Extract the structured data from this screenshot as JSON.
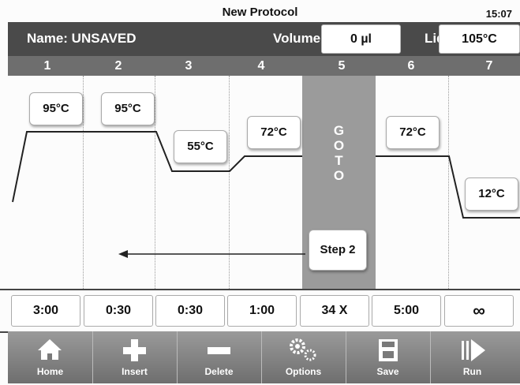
{
  "header": {
    "title": "New Protocol",
    "time": "15:07"
  },
  "protocol": {
    "name_label": "Name: UNSAVED",
    "volume_label": "Volume",
    "volume_value": "0 µl",
    "lid_label": "Lid",
    "lid_value": "105°C"
  },
  "steps": [
    {
      "number": "1",
      "temp": "95°C",
      "duration": "3:00"
    },
    {
      "number": "2",
      "temp": "95°C",
      "duration": "0:30"
    },
    {
      "number": "3",
      "temp": "55°C",
      "duration": "0:30"
    },
    {
      "number": "4",
      "temp": "72°C",
      "duration": "1:00"
    },
    {
      "number": "5",
      "goto_text": "G\nO\nT\nO",
      "goto_target": "Step 2",
      "duration": "34 X"
    },
    {
      "number": "6",
      "temp": "72°C",
      "duration": "5:00"
    },
    {
      "number": "7",
      "temp": "12°C",
      "duration": "∞"
    }
  ],
  "toolbar": [
    {
      "label": "Home",
      "icon": "home-icon"
    },
    {
      "label": "Insert",
      "icon": "plus-icon"
    },
    {
      "label": "Delete",
      "icon": "minus-icon"
    },
    {
      "label": "Options",
      "icon": "gears-icon"
    },
    {
      "label": "Save",
      "icon": "save-icon"
    },
    {
      "label": "Run",
      "icon": "run-icon"
    }
  ],
  "colors": {
    "bar_dark": "#4a4a4a",
    "step_header": "#6e6e6e",
    "goto_column": "#9b9b9b"
  }
}
